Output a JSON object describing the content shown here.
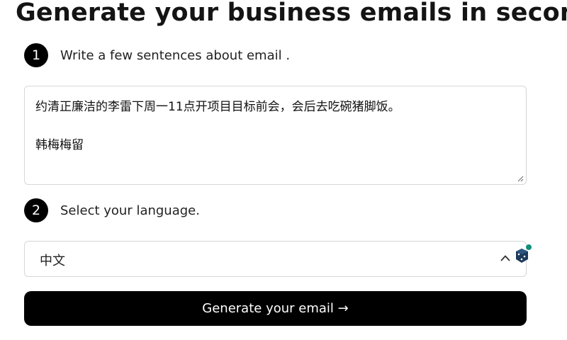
{
  "header": {
    "title": "Generate your business emails in seconds"
  },
  "step1": {
    "number": "1",
    "label": "Write a few sentences about email ."
  },
  "message": {
    "lines": [
      "约清正廉洁的李雷下周一11点开项目目标前会，会后去吃碗猪脚饭。",
      "",
      "韩梅梅留"
    ]
  },
  "step2": {
    "number": "2",
    "label": "Select your language."
  },
  "language": {
    "selected": "中文",
    "chevron_icon": "chevron-up-icon"
  },
  "extension": {
    "icon": "dice-extension-icon",
    "badge_color": "#0f8f7a",
    "icon_color": "#1d3a5c"
  },
  "generate": {
    "label": "Generate your email →"
  }
}
